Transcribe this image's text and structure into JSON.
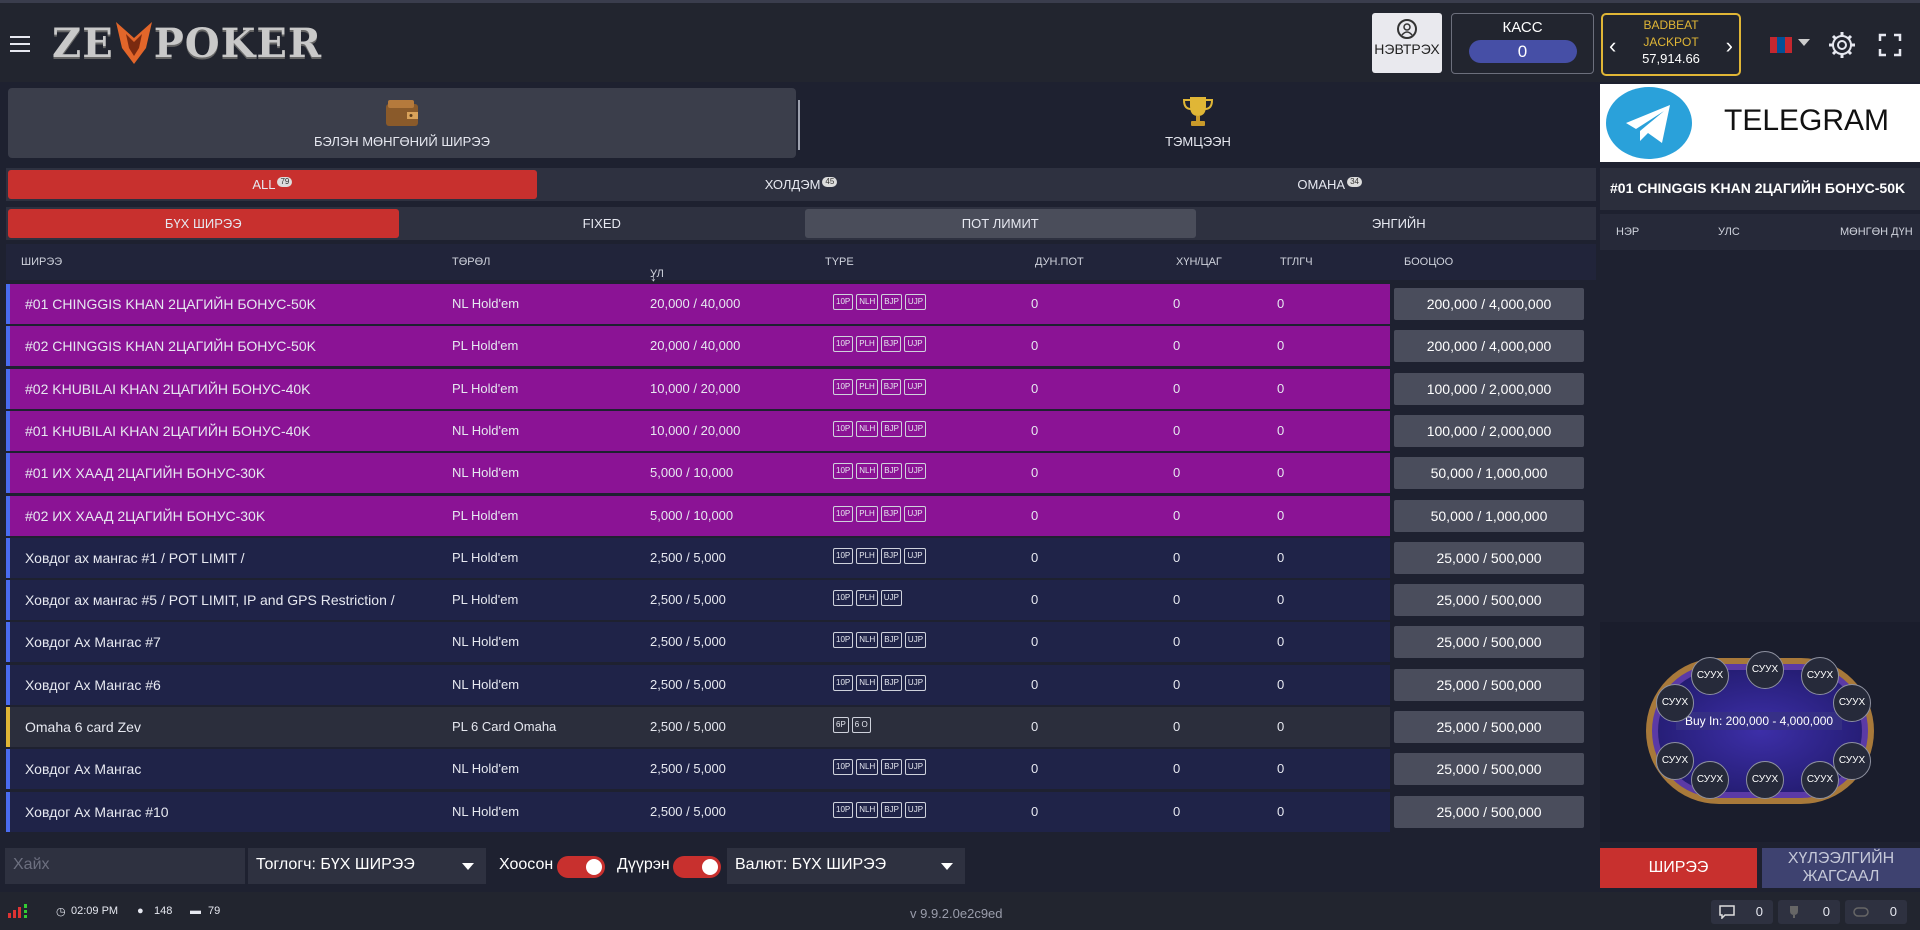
{
  "header": {
    "logo_text_left": "ZE",
    "logo_text_right": "POKER",
    "login_label": "НЭВТРЭХ",
    "cashier_label": "КАСС",
    "cashier_value": "0",
    "jackpot_label_1": "BADBEAT",
    "jackpot_label_2": "JACKPOT",
    "jackpot_value": "57,914.66",
    "flag_colors": [
      "#c4272f",
      "#015197",
      "#c4272f"
    ],
    "icons": [
      "menu-icon",
      "user-icon",
      "chevron-left-icon",
      "chevron-right-icon",
      "gear-icon",
      "fullscreen-icon"
    ]
  },
  "categories": {
    "cash_label": "БЭЛЭН МӨНГӨНИЙ ШИРЭЭ",
    "tournament_label": "ТЭМЦЭЭН"
  },
  "game_tabs": [
    {
      "label": "ALL",
      "count": "79"
    },
    {
      "label": "ХОЛДЭМ",
      "count": "45"
    },
    {
      "label": "ОМАНА",
      "count": "34"
    }
  ],
  "limit_tabs": [
    "БҮХ ШИРЭЭ",
    "FIXED",
    "ПОТ ЛИМИТ",
    "ЭНГИЙН"
  ],
  "table_headers": {
    "name": "ШИРЭЭ",
    "type": "ТӨРӨЛ",
    "blinds": "УЛ",
    "game_type": "TYPE",
    "avg_pot": "ДУН.ПОТ",
    "hands_per_hour": "ХҮН/ЦАГ",
    "players": "ТГЛГЧ",
    "buyin": "БООЦОО"
  },
  "rows": [
    {
      "name": "#01 CHINGGIS KHAN 2ЦАГИЙН БОНУС-50K",
      "type": "NL Hold'em",
      "blinds": "20,000 / 40,000",
      "badges": [
        "10P",
        "NLH",
        "BJP",
        "UJP"
      ],
      "pot": "0",
      "plph": "0",
      "players": "0",
      "buyin": "200,000 / 4,000,000",
      "style": "promo"
    },
    {
      "name": "#02 CHINGGIS KHAN 2ЦАГИЙН БОНУС-50K",
      "type": "PL Hold'em",
      "blinds": "20,000 / 40,000",
      "badges": [
        "10P",
        "PLH",
        "BJP",
        "UJP"
      ],
      "pot": "0",
      "plph": "0",
      "players": "0",
      "buyin": "200,000 / 4,000,000",
      "style": "promo"
    },
    {
      "name": "#02 KHUBILAI KHAN 2ЦАГИЙН БОНУС-40K",
      "type": "PL Hold'em",
      "blinds": "10,000 / 20,000",
      "badges": [
        "10P",
        "PLH",
        "BJP",
        "UJP"
      ],
      "pot": "0",
      "plph": "0",
      "players": "0",
      "buyin": "100,000 / 2,000,000",
      "style": "promo"
    },
    {
      "name": "#01 KHUBILAI KHAN 2ЦАГИЙН БОНУС-40K",
      "type": "NL Hold'em",
      "blinds": "10,000 / 20,000",
      "badges": [
        "10P",
        "NLH",
        "BJP",
        "UJP"
      ],
      "pot": "0",
      "plph": "0",
      "players": "0",
      "buyin": "100,000 / 2,000,000",
      "style": "promo"
    },
    {
      "name": "#01 ИХ ХААД 2ЦАГИЙН БОНУС-30K",
      "type": "NL Hold'em",
      "blinds": "5,000 / 10,000",
      "badges": [
        "10P",
        "NLH",
        "BJP",
        "UJP"
      ],
      "pot": "0",
      "plph": "0",
      "players": "0",
      "buyin": "50,000 / 1,000,000",
      "style": "promo"
    },
    {
      "name": "#02 ИХ ХААД 2ЦАГИЙН БОНУС-30K",
      "type": "PL Hold'em",
      "blinds": "5,000 / 10,000",
      "badges": [
        "10P",
        "PLH",
        "BJP",
        "UJP"
      ],
      "pot": "0",
      "plph": "0",
      "players": "0",
      "buyin": "50,000 / 1,000,000",
      "style": "promo"
    },
    {
      "name": "Ховдог ах мангас #1 / POT LIMIT /",
      "type": "PL Hold'em",
      "blinds": "2,500 / 5,000",
      "badges": [
        "10P",
        "PLH",
        "BJP",
        "UJP"
      ],
      "pot": "0",
      "plph": "0",
      "players": "0",
      "buyin": "25,000 / 500,000",
      "style": "normal"
    },
    {
      "name": "Ховдог ах мангас #5 / POT LIMIT, IP and GPS Restriction /",
      "type": "PL Hold'em",
      "blinds": "2,500 / 5,000",
      "badges": [
        "10P",
        "PLH",
        "UJP"
      ],
      "pot": "0",
      "plph": "0",
      "players": "0",
      "buyin": "25,000 / 500,000",
      "style": "normal"
    },
    {
      "name": "Ховдог Ах Мангас #7",
      "type": "NL Hold'em",
      "blinds": "2,500 / 5,000",
      "badges": [
        "10P",
        "NLH",
        "BJP",
        "UJP"
      ],
      "pot": "0",
      "plph": "0",
      "players": "0",
      "buyin": "25,000 / 500,000",
      "style": "normal"
    },
    {
      "name": "Ховдог Ах Мангас #6",
      "type": "NL Hold'em",
      "blinds": "2,500 / 5,000",
      "badges": [
        "10P",
        "NLH",
        "BJP",
        "UJP"
      ],
      "pot": "0",
      "plph": "0",
      "players": "0",
      "buyin": "25,000 / 500,000",
      "style": "normal"
    },
    {
      "name": "Omaha 6 card Zev",
      "type": "PL 6 Card Omaha",
      "blinds": "2,500 / 5,000",
      "badges": [
        "6P",
        "6 O"
      ],
      "pot": "0",
      "plph": "0",
      "players": "0",
      "buyin": "25,000 / 500,000",
      "style": "omaha"
    },
    {
      "name": "Ховдог Ах Мангас",
      "type": "NL Hold'em",
      "blinds": "2,500 / 5,000",
      "badges": [
        "10P",
        "NLH",
        "BJP",
        "UJP"
      ],
      "pot": "0",
      "plph": "0",
      "players": "0",
      "buyin": "25,000 / 500,000",
      "style": "normal"
    },
    {
      "name": "Ховдог Ах Мангас #10",
      "type": "NL Hold'em",
      "blinds": "2,500 / 5,000",
      "badges": [
        "10P",
        "NLH",
        "BJP",
        "UJP"
      ],
      "pot": "0",
      "plph": "0",
      "players": "0",
      "buyin": "25,000 / 500,000",
      "style": "normal"
    }
  ],
  "filters": {
    "search_placeholder": "Хайх",
    "players_select": "Тоглогч: БҮХ ШИРЭЭ",
    "empty_label": "Хоосон",
    "full_label": "Дүүрэн",
    "currency_select": "Валют: БҮХ ШИРЭЭ"
  },
  "status": {
    "time": "02:09 PM",
    "users": "148",
    "tables": "79",
    "version": "v 9.9.2.0e2c9ed",
    "chat_count": "0",
    "tourn_count": "0",
    "other_count": "0"
  },
  "right_panel": {
    "telegram_label": "TELEGRAM",
    "selected_table": "#01 CHINGGIS KHAN 2ЦАГИЙН БОНУС-50K",
    "col_name": "НЭР",
    "col_country": "УЛС",
    "col_money": "МӨНГӨН ДҮН",
    "seat_label": "СУУХ",
    "buyin_label": "Buy In: 200,000 - 4,000,000",
    "seat_button": "ШИРЭЭ",
    "waitlist_button_1": "ХҮЛЭЭЛГИЙН",
    "waitlist_button_2": "ЖАГСААЛ"
  },
  "colors": {
    "promo_row": "#8b1395",
    "normal_row": "#1f2348",
    "omaha_row": "#2b2e3c",
    "accent_red": "#c8302e",
    "accent_gold": "#e0b636"
  }
}
